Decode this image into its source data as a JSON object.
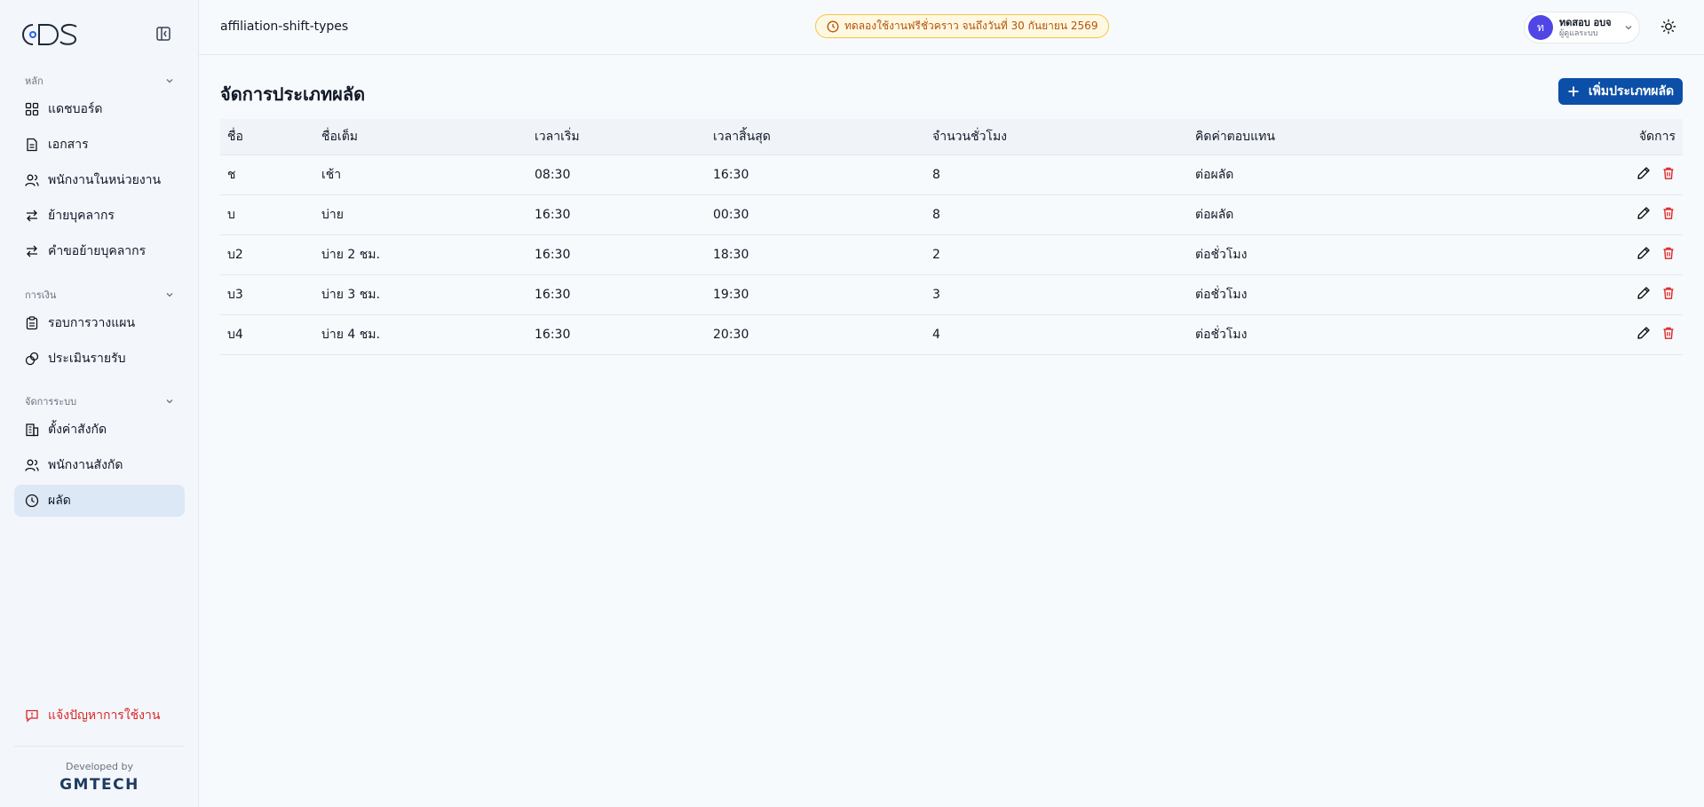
{
  "brand": {
    "logo_text": "ODS"
  },
  "sidebar": {
    "sections": [
      {
        "title": "หลัก",
        "items": [
          {
            "label": "แดชบอร์ด",
            "icon": "dashboard-icon"
          },
          {
            "label": "เอกสาร",
            "icon": "document-icon"
          },
          {
            "label": "พนักงานในหน่วยงาน",
            "icon": "users-icon"
          },
          {
            "label": "ย้ายบุคลากร",
            "icon": "transfer-icon"
          },
          {
            "label": "คำขอย้ายบุคลากร",
            "icon": "transfer-icon"
          }
        ]
      },
      {
        "title": "การเงิน",
        "items": [
          {
            "label": "รอบการวางแผน",
            "icon": "clipboard-icon"
          },
          {
            "label": "ประเมินรายรับ",
            "icon": "coins-icon"
          }
        ]
      },
      {
        "title": "จัดการระบบ",
        "items": [
          {
            "label": "ตั้งค่าสังกัด",
            "icon": "building-icon"
          },
          {
            "label": "พนักงานสังกัด",
            "icon": "users-icon"
          },
          {
            "label": "ผลัด",
            "icon": "clock-icon",
            "active": true
          }
        ]
      }
    ],
    "report_label": "แจ้งปัญหาการใช้งาน",
    "developed_by": "Developed by",
    "developer": "GMTECH"
  },
  "header": {
    "breadcrumb": "affiliation-shift-types",
    "trial_notice": "ทดลองใช้งานฟรีชั่วคราว จนถึงวันที่ 30 กันยายน 2569",
    "user": {
      "initial": "ท",
      "name": "ทดสอบ อบจ",
      "role": "ผู้ดูแลระบบ"
    }
  },
  "main": {
    "title": "จัดการประเภทผลัด",
    "add_button": "เพิ่มประเภทผลัด",
    "columns": [
      "ชื่อ",
      "ชื่อเต็ม",
      "เวลาเริ่ม",
      "เวลาสิ้นสุด",
      "จำนวนชั่วโมง",
      "คิดค่าตอบแทน",
      "จัดการ"
    ],
    "rows": [
      [
        "ช",
        "เช้า",
        "08:30",
        "16:30",
        "8",
        "ต่อผลัด"
      ],
      [
        "บ",
        "บ่าย",
        "16:30",
        "00:30",
        "8",
        "ต่อผลัด"
      ],
      [
        "บ2",
        "บ่าย 2 ชม.",
        "16:30",
        "18:30",
        "2",
        "ต่อชั่วโมง"
      ],
      [
        "บ3",
        "บ่าย 3 ชม.",
        "16:30",
        "19:30",
        "3",
        "ต่อชั่วโมง"
      ],
      [
        "บ4",
        "บ่าย 4 ชม.",
        "16:30",
        "20:30",
        "4",
        "ต่อชั่วโมง"
      ]
    ]
  },
  "colors": {
    "primary": "#0b4fa8",
    "danger": "#dc2626",
    "warning": "#b45309",
    "active_bg": "#dde8f6"
  }
}
